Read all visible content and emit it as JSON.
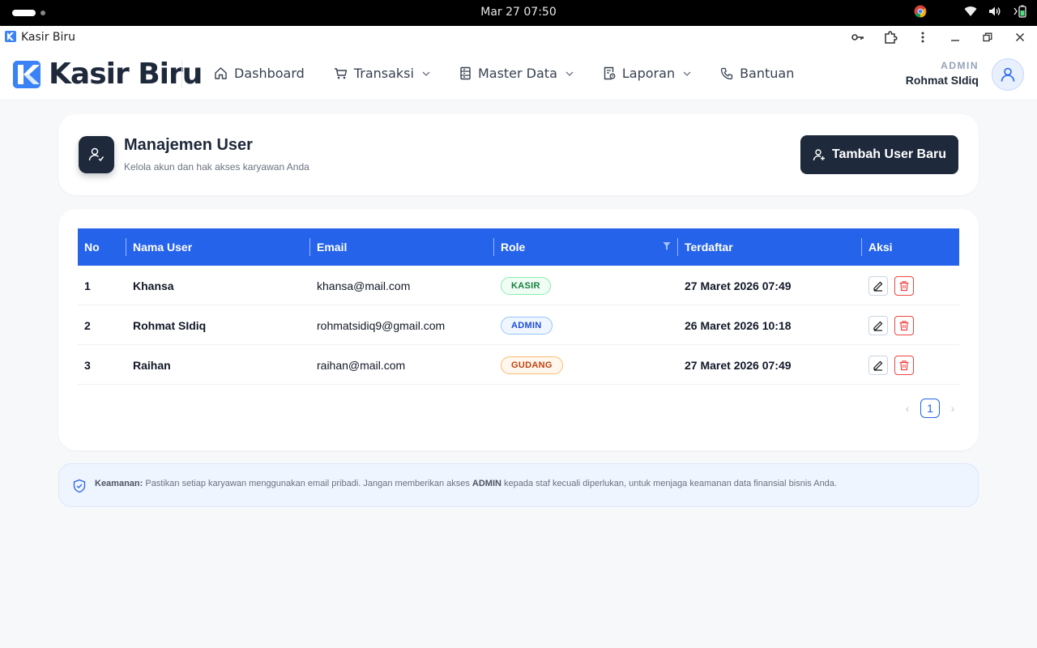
{
  "os": {
    "clock": "Mar 27  07:50"
  },
  "window": {
    "title": "Kasir Biru"
  },
  "header": {
    "brand": "Kasir Biru",
    "nav": [
      {
        "label": "Dashboard",
        "icon": "home-icon",
        "dropdown": false
      },
      {
        "label": "Transaksi",
        "icon": "cart-icon",
        "dropdown": true
      },
      {
        "label": "Master Data",
        "icon": "database-icon",
        "dropdown": true
      },
      {
        "label": "Laporan",
        "icon": "report-icon",
        "dropdown": true
      },
      {
        "label": "Bantuan",
        "icon": "phone-icon",
        "dropdown": false
      }
    ],
    "user_role": "ADMIN",
    "user_name": "Rohmat SIdiq"
  },
  "page": {
    "title": "Manajemen User",
    "subtitle": "Kelola akun dan hak akses karyawan Anda",
    "add_button": "Tambah User Baru"
  },
  "table": {
    "columns": [
      "No",
      "Nama User",
      "Email",
      "Role",
      "Terdaftar",
      "Aksi"
    ],
    "rows": [
      {
        "no": "1",
        "name": "Khansa",
        "email": "khansa@mail.com",
        "role": "KASIR",
        "registered": "27 Maret 2026 07:49"
      },
      {
        "no": "2",
        "name": "Rohmat SIdiq",
        "email": "rohmatsidiq9@gmail.com",
        "role": "ADMIN",
        "registered": "26 Maret 2026 10:18"
      },
      {
        "no": "3",
        "name": "Raihan",
        "email": "raihan@mail.com",
        "role": "GUDANG",
        "registered": "27 Maret 2026 07:49"
      }
    ],
    "pagination": {
      "current": "1"
    }
  },
  "info": {
    "label": "Keamanan:",
    "text_before": " Pastikan setiap karyawan menggunakan email pribadi. Jangan memberikan akses ",
    "highlight": "ADMIN",
    "text_after": " kepada staf kecuali diperlukan, untuk menjaga keamanan data finansial bisnis Anda."
  },
  "colors": {
    "primary": "#2563eb",
    "dark": "#1e293b",
    "kasir": "#15803d",
    "admin": "#1d4ed8",
    "gudang": "#c2410c"
  }
}
